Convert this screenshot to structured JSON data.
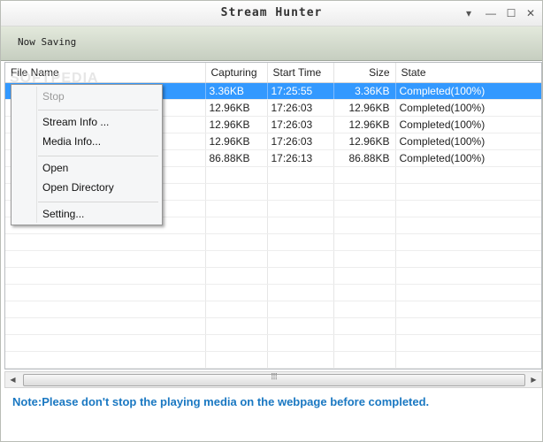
{
  "window": {
    "title": "Stream Hunter",
    "controls": {
      "dropdown": "▾",
      "minimize": "—",
      "maximize": "☐",
      "close": "✕"
    }
  },
  "toolbar": {
    "status": "Now Saving"
  },
  "table": {
    "headers": [
      "File Name",
      "Capturing",
      "Start Time",
      "Size",
      "State"
    ],
    "rows": [
      [
        "",
        "3.36KB",
        "17:25:55",
        "3.36KB",
        "Completed(100%)"
      ],
      [
        "",
        "12.96KB",
        "17:26:03",
        "12.96KB",
        "Completed(100%)"
      ],
      [
        "",
        "12.96KB",
        "17:26:03",
        "12.96KB",
        "Completed(100%)"
      ],
      [
        "",
        "12.96KB",
        "17:26:03",
        "12.96KB",
        "Completed(100%)"
      ],
      [
        "",
        "86.88KB",
        "17:26:13",
        "86.88KB",
        "Completed(100%)"
      ]
    ]
  },
  "context_menu": {
    "stop": "Stop",
    "stream_info": "Stream Info ...",
    "media_info": "Media Info...",
    "open": "Open",
    "open_directory": "Open Directory",
    "setting": "Setting..."
  },
  "scrollbar": {
    "left_arrow": "◀",
    "right_arrow": "▶",
    "grip": "⦙⦙⦙"
  },
  "note": "Note:Please don't stop the playing media on the webpage before completed.",
  "watermark": "SOFTPEDIA",
  "colors": {
    "selection": "#3399ff",
    "note_text": "#1a78c2",
    "toolbar": "#d4dacd"
  }
}
